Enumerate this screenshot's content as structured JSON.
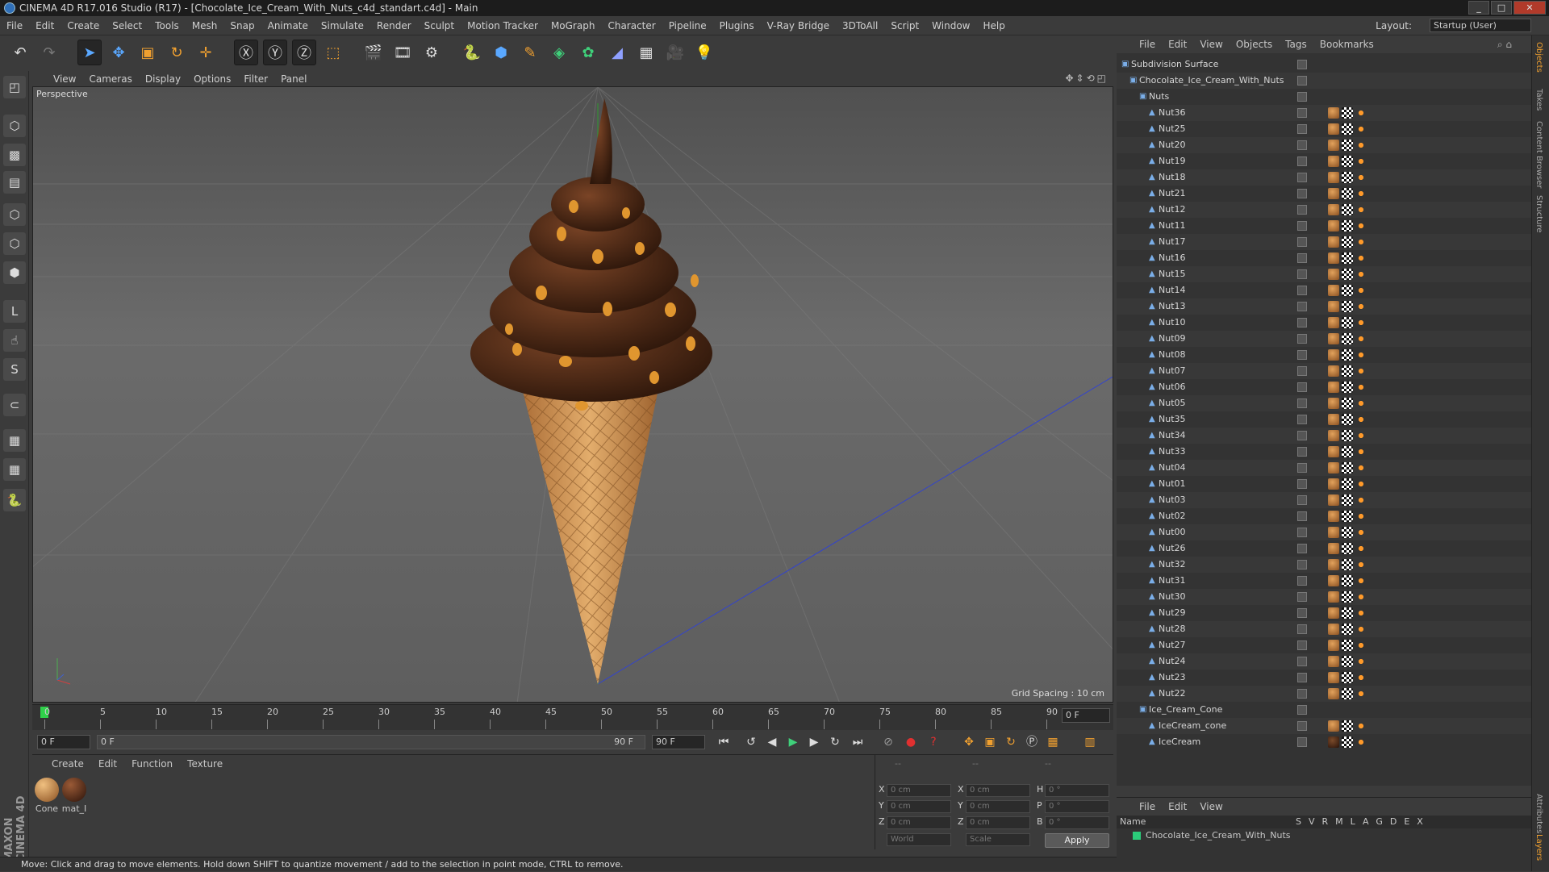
{
  "title": "CINEMA 4D R17.016 Studio (R17) - [Chocolate_Ice_Cream_With_Nuts_c4d_standart.c4d] - Main",
  "menu": [
    "File",
    "Edit",
    "Create",
    "Select",
    "Tools",
    "Mesh",
    "Snap",
    "Animate",
    "Simulate",
    "Render",
    "Sculpt",
    "Motion Tracker",
    "MoGraph",
    "Character",
    "Pipeline",
    "Plugins",
    "V-Ray Bridge",
    "3DToAll",
    "Script",
    "Window",
    "Help"
  ],
  "layout": {
    "label": "Layout:",
    "value": "Startup (User)"
  },
  "viewport": {
    "menu": [
      "View",
      "Cameras",
      "Display",
      "Options",
      "Filter",
      "Panel"
    ],
    "label": "Perspective",
    "grid_spacing": "Grid Spacing : 10 cm"
  },
  "timeline": {
    "ticks": [
      "0",
      "5",
      "10",
      "15",
      "20",
      "25",
      "30",
      "35",
      "40",
      "45",
      "50",
      "55",
      "60",
      "65",
      "70",
      "75",
      "80",
      "85",
      "90"
    ],
    "frame_display": "0 F",
    "start": "0 F",
    "range_start": "0 F",
    "range_end": "90 F",
    "end": "90 F"
  },
  "materials": {
    "menu": [
      "Create",
      "Edit",
      "Function",
      "Texture"
    ],
    "items": [
      {
        "name": "Cone",
        "color": "#c88a4a"
      },
      {
        "name": "mat_I",
        "color": "#5a2e18"
      }
    ]
  },
  "coords": {
    "header": [
      "--",
      "--",
      "--"
    ],
    "rows": [
      [
        "X",
        "0 cm",
        "X",
        "0 cm",
        "H",
        "0 °"
      ],
      [
        "Y",
        "0 cm",
        "Y",
        "0 cm",
        "P",
        "0 °"
      ],
      [
        "Z",
        "0 cm",
        "Z",
        "0 cm",
        "B",
        "0 °"
      ]
    ],
    "world": "World",
    "scale": "Scale",
    "apply": "Apply"
  },
  "status": "Move: Click and drag to move elements. Hold down SHIFT to quantize movement / add to the selection in point mode, CTRL to remove.",
  "objects": {
    "menu": [
      "File",
      "Edit",
      "View",
      "Objects",
      "Tags",
      "Bookmarks"
    ],
    "tree": [
      {
        "name": "Subdivision Surface",
        "level": 0,
        "tags": ""
      },
      {
        "name": "Chocolate_Ice_Cream_With_Nuts",
        "level": 1,
        "tags": ""
      },
      {
        "name": "Nuts",
        "level": 2,
        "tags": ""
      },
      {
        "name": "Nut36",
        "level": 3,
        "tags": "n"
      },
      {
        "name": "Nut25",
        "level": 3,
        "tags": "n"
      },
      {
        "name": "Nut20",
        "level": 3,
        "tags": "n"
      },
      {
        "name": "Nut19",
        "level": 3,
        "tags": "n"
      },
      {
        "name": "Nut18",
        "level": 3,
        "tags": "n"
      },
      {
        "name": "Nut21",
        "level": 3,
        "tags": "n"
      },
      {
        "name": "Nut12",
        "level": 3,
        "tags": "n"
      },
      {
        "name": "Nut11",
        "level": 3,
        "tags": "n"
      },
      {
        "name": "Nut17",
        "level": 3,
        "tags": "n"
      },
      {
        "name": "Nut16",
        "level": 3,
        "tags": "n"
      },
      {
        "name": "Nut15",
        "level": 3,
        "tags": "n"
      },
      {
        "name": "Nut14",
        "level": 3,
        "tags": "n"
      },
      {
        "name": "Nut13",
        "level": 3,
        "tags": "n"
      },
      {
        "name": "Nut10",
        "level": 3,
        "tags": "n"
      },
      {
        "name": "Nut09",
        "level": 3,
        "tags": "n"
      },
      {
        "name": "Nut08",
        "level": 3,
        "tags": "n"
      },
      {
        "name": "Nut07",
        "level": 3,
        "tags": "n"
      },
      {
        "name": "Nut06",
        "level": 3,
        "tags": "n"
      },
      {
        "name": "Nut05",
        "level": 3,
        "tags": "n"
      },
      {
        "name": "Nut35",
        "level": 3,
        "tags": "n"
      },
      {
        "name": "Nut34",
        "level": 3,
        "tags": "n"
      },
      {
        "name": "Nut33",
        "level": 3,
        "tags": "n"
      },
      {
        "name": "Nut04",
        "level": 3,
        "tags": "n"
      },
      {
        "name": "Nut01",
        "level": 3,
        "tags": "n"
      },
      {
        "name": "Nut03",
        "level": 3,
        "tags": "n"
      },
      {
        "name": "Nut02",
        "level": 3,
        "tags": "n"
      },
      {
        "name": "Nut00",
        "level": 3,
        "tags": "n"
      },
      {
        "name": "Nut26",
        "level": 3,
        "tags": "n"
      },
      {
        "name": "Nut32",
        "level": 3,
        "tags": "n"
      },
      {
        "name": "Nut31",
        "level": 3,
        "tags": "n"
      },
      {
        "name": "Nut30",
        "level": 3,
        "tags": "n"
      },
      {
        "name": "Nut29",
        "level": 3,
        "tags": "n"
      },
      {
        "name": "Nut28",
        "level": 3,
        "tags": "n"
      },
      {
        "name": "Nut27",
        "level": 3,
        "tags": "n"
      },
      {
        "name": "Nut24",
        "level": 3,
        "tags": "n"
      },
      {
        "name": "Nut23",
        "level": 3,
        "tags": "n"
      },
      {
        "name": "Nut22",
        "level": 3,
        "tags": "n"
      },
      {
        "name": "Ice_Cream_Cone",
        "level": 2,
        "tags": ""
      },
      {
        "name": "IceCream_cone",
        "level": 3,
        "tags": "n"
      },
      {
        "name": "IceCream",
        "level": 3,
        "tags": "d"
      }
    ]
  },
  "right_tabs": [
    "Objects",
    "Takes",
    "Content Browser",
    "Structure",
    "Attributes",
    "Layers"
  ],
  "attributes": {
    "menu": [
      "File",
      "Edit",
      "View"
    ],
    "name_header": "Name",
    "cols": "SVRMLAGDEX",
    "row": "Chocolate_Ice_Cream_With_Nuts",
    "layer_color": "#2bcc7a"
  },
  "brand": "MAXON CINEMA 4D"
}
